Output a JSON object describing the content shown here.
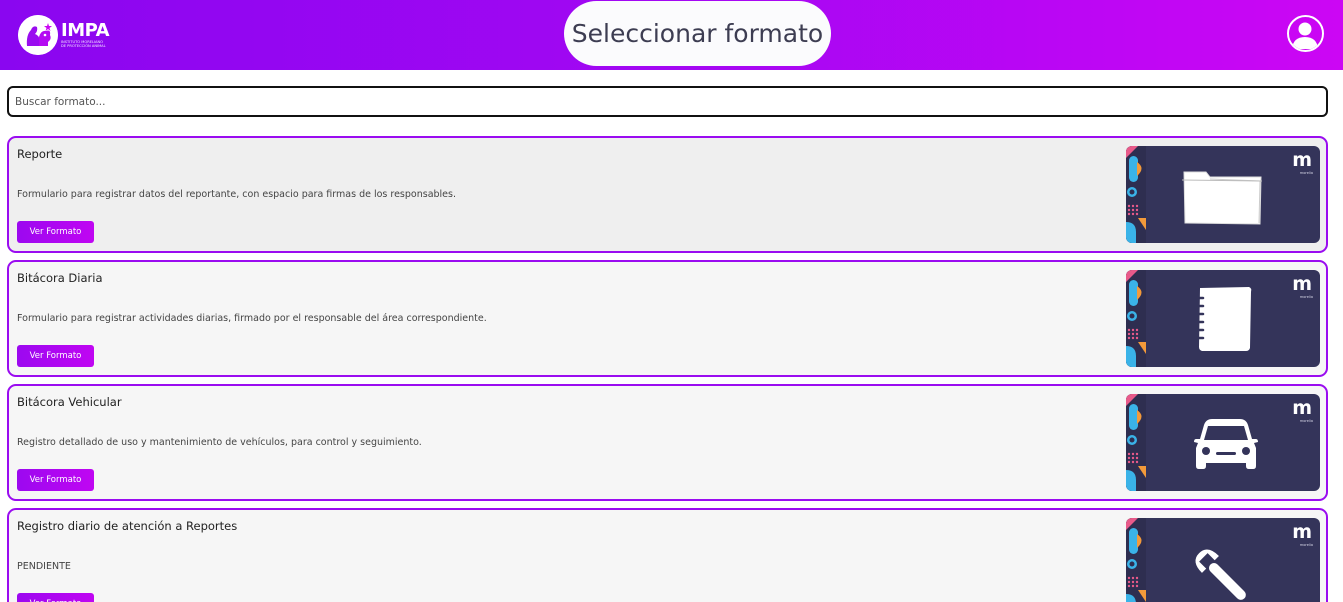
{
  "header": {
    "logo_text": "IMPA",
    "logo_subtext": "INSTITUTO MORELIANO DE PROTECCIÓN ANIMAL",
    "title": "Seleccionar formato"
  },
  "search": {
    "placeholder": "Buscar formato..."
  },
  "formats": [
    {
      "title": "Reporte",
      "description": "Formulario para registrar datos del reportante, con espacio para firmas de los responsables.",
      "button": "Ver Formato",
      "icon": "folder-icon"
    },
    {
      "title": "Bitácora Diaria",
      "description": "Formulario para registrar actividades diarias, firmado por el responsable del área correspondiente.",
      "button": "Ver Formato",
      "icon": "notebook-icon"
    },
    {
      "title": "Bitácora Vehicular",
      "description": "Registro detallado de uso y mantenimiento de vehículos, para control y seguimiento.",
      "button": "Ver Formato",
      "icon": "car-icon"
    },
    {
      "title": "Registro diario de atención a Reportes",
      "description": "PENDIENTE",
      "button": "Ver Formato",
      "icon": "wrench-icon"
    }
  ],
  "thumbnail_brand": {
    "letter": "m",
    "subtext": "morelia"
  },
  "colors": {
    "header_gradient_start": "#8a06f0",
    "header_gradient_end": "#cc06f4",
    "accent_border": "#9a0cf0",
    "thumbnail_bg": "#34345a",
    "title_pill_bg": "#fbfbfd"
  }
}
